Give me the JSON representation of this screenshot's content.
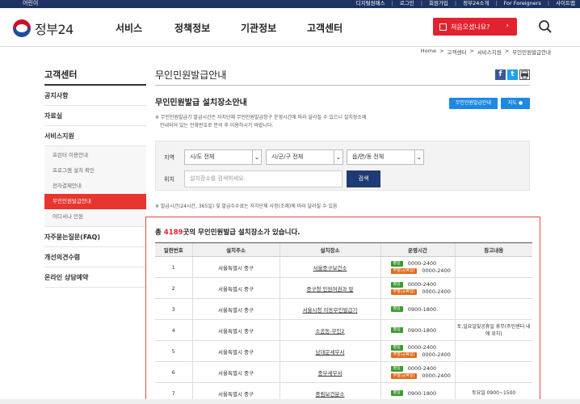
{
  "topbar": {
    "kids": "어린이",
    "links": [
      "디지털원패스",
      "로그인",
      "회원가입",
      "정부24소개",
      "For Foreigners",
      "사이트맵"
    ]
  },
  "header": {
    "logo_text": "정부24",
    "gnb": [
      "서비스",
      "정책정보",
      "기관정보",
      "고객센터"
    ],
    "help_button": "처음오셨나요?"
  },
  "breadcrumb": [
    "Home",
    ">",
    "고객센터",
    ">",
    "서비스지원",
    ">",
    "무인민원발급안내"
  ],
  "sidebar": {
    "title": "고객센터",
    "items_top": [
      "공지사항",
      "자료실",
      "서비스지원"
    ],
    "sub_items": [
      "프린터 이용안내",
      "프로그램 설치 확인",
      "전자결제안내",
      "무인민원발급안내",
      "어디서나 민원"
    ],
    "active_sub": 3,
    "items_bottom": [
      "자주묻는질문(FAQ)",
      "개선의견수렴",
      "온라인 상담예약"
    ]
  },
  "content": {
    "page_title": "무인민원발급안내",
    "share": [
      "f",
      "t",
      "p"
    ],
    "section_title": "무인민원발급 설치장소안내",
    "btn_info": "무인민원발급안내",
    "btn_map": "지도",
    "notice_line1": "※ 무인민원발급기 발급시간은 자치단체 무인민원발급창구 운영시간에 따라 달라질 수 있으니 설치장소에",
    "notice_line2": "안내되어 있는 전화번호로 문의 후 이용하시기 바랍니다.",
    "filter": {
      "region_label": "지역",
      "sido": "시/도 전체",
      "sigungu": "시/군/구 전체",
      "eupmyeon": "읍/면/동 전체",
      "location_label": "위치",
      "location_placeholder": "설치장소를 검색하세요.",
      "search_button": "검색"
    },
    "notice2": "※ 발급시간(24시간, 365일) 및 발급수수료는 자치단체 사정(조례)에 따라 달라질 수 있음"
  },
  "result": {
    "prefix": "총 ",
    "count": "4189",
    "suffix": "곳의 무인민원발급 설치장소가 있습니다.",
    "columns": [
      "일련번호",
      "설치주소",
      "설치장소",
      "운영시간",
      "참고내용"
    ],
    "badge_weekday": "평일",
    "badge_holiday": "주말(공휴일)",
    "rows": [
      {
        "no": "1",
        "addr": "서울특별시 중구",
        "place": "서울중구보건소",
        "weekday": "0000-2400",
        "holiday": "0000-2400",
        "note": ""
      },
      {
        "no": "2",
        "addr": "서울특별시 중구",
        "place": "중구청 민원여권과 앞",
        "weekday": "0000-2400",
        "holiday": "0000-2400",
        "note": ""
      },
      {
        "no": "3",
        "addr": "서울특별시 중구",
        "place": "서울시청 이동무인발급기",
        "weekday": "0900-1800",
        "holiday": "",
        "note": ""
      },
      {
        "no": "4",
        "addr": "서울특별시 중구",
        "place": "소공동-무인2",
        "weekday": "0900-1800",
        "holiday": "",
        "note": "토,일요일및공휴일 휴무(주민센터 내에 위치)"
      },
      {
        "no": "5",
        "addr": "서울특별시 중구",
        "place": "남대문세무서",
        "weekday": "0000-2400",
        "holiday": "0000-2400",
        "note": ""
      },
      {
        "no": "6",
        "addr": "서울특별시 중구",
        "place": "중부세무서",
        "weekday": "0000-2400",
        "holiday": "0000-2400",
        "note": ""
      },
      {
        "no": "7",
        "addr": "서울특별시 중구",
        "place": "중림보건분소",
        "weekday": "0900-1800",
        "holiday": "",
        "note": "토요일 0900~1500"
      }
    ]
  },
  "colors": {
    "navy": "#1e3263",
    "accent_red": "#e3222f",
    "blue_button": "#1e88e5",
    "search_navy": "#1f3b73"
  }
}
